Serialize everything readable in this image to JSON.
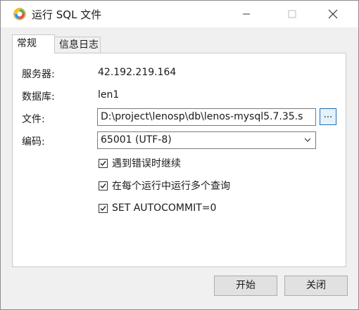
{
  "window": {
    "title": "运行 SQL 文件"
  },
  "tabs": [
    {
      "label": "常规",
      "active": true
    },
    {
      "label": "信息日志",
      "active": false
    }
  ],
  "general": {
    "server_label": "服务器:",
    "server_value": "42.192.219.164",
    "database_label": "数据库:",
    "database_value": "len1",
    "file_label": "文件:",
    "file_value": "D:\\project\\lenosp\\db\\lenos-mysql5.7.35.s",
    "browse_label": "...",
    "encoding_label": "编码:",
    "encoding_value": "65001 (UTF-8)"
  },
  "options": [
    {
      "label": "遇到错误时继续",
      "checked": true
    },
    {
      "label": "在每个运行中运行多个查询",
      "checked": true
    },
    {
      "label": "SET AUTOCOMMIT=0",
      "checked": true
    }
  ],
  "footer": {
    "start_label": "开始",
    "close_label": "关闭"
  },
  "icons": {
    "app": "navicat-icon",
    "minimize": "minimize-icon",
    "maximize": "maximize-icon",
    "close": "close-icon",
    "dropdown": "chevron-down-icon",
    "check": "check-icon"
  }
}
